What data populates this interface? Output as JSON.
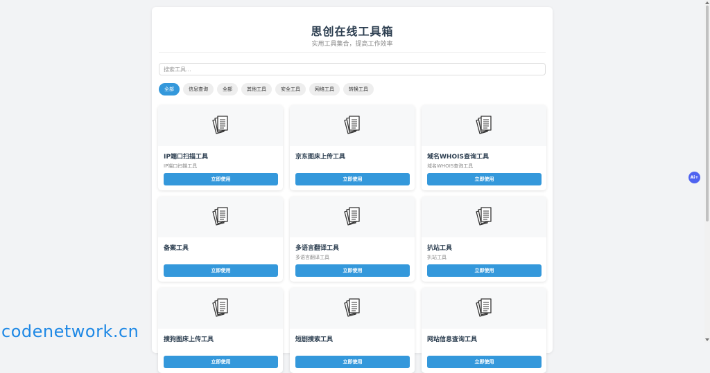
{
  "header": {
    "title": "思创在线工具箱",
    "subtitle": "实用工具集合，提高工作效率"
  },
  "search": {
    "placeholder": "搜索工具..."
  },
  "filters": [
    {
      "label": "全部",
      "active": true
    },
    {
      "label": "信息查询",
      "active": false
    },
    {
      "label": "全部",
      "active": false
    },
    {
      "label": "其他工具",
      "active": false
    },
    {
      "label": "安全工具",
      "active": false
    },
    {
      "label": "网络工具",
      "active": false
    },
    {
      "label": "转换工具",
      "active": false
    }
  ],
  "cards": [
    {
      "name": "IP端口扫描工具",
      "desc": "IP端口扫描工具",
      "button": "立即使用",
      "icon": "document-stack-icon"
    },
    {
      "name": "京东图床上传工具",
      "desc": "",
      "button": "立即使用",
      "icon": "document-stack-icon"
    },
    {
      "name": "域名WHOIS查询工具",
      "desc": "域名WHOIS查询工具",
      "button": "立即使用",
      "icon": "document-stack-icon"
    },
    {
      "name": "备案工具",
      "desc": "",
      "button": "立即使用",
      "icon": "document-stack-icon"
    },
    {
      "name": "多语言翻译工具",
      "desc": "多语言翻译工具",
      "button": "立即使用",
      "icon": "document-stack-icon"
    },
    {
      "name": "扒站工具",
      "desc": "扒站工具",
      "button": "立即使用",
      "icon": "document-stack-icon"
    },
    {
      "name": "搜狗图床上传工具",
      "desc": "",
      "button": "立即使用",
      "icon": "document-stack-icon"
    },
    {
      "name": "短剧搜索工具",
      "desc": "",
      "button": "立即使用",
      "icon": "document-stack-icon"
    },
    {
      "name": "网站信息查询工具",
      "desc": "",
      "button": "立即使用",
      "icon": "document-stack-icon"
    }
  ],
  "floating": {
    "ai_label": "Ai+"
  },
  "watermark": "codenetwork.cn",
  "colors": {
    "accent": "#3498db",
    "title": "#2c3e50",
    "watermark": "#1e88e5"
  }
}
